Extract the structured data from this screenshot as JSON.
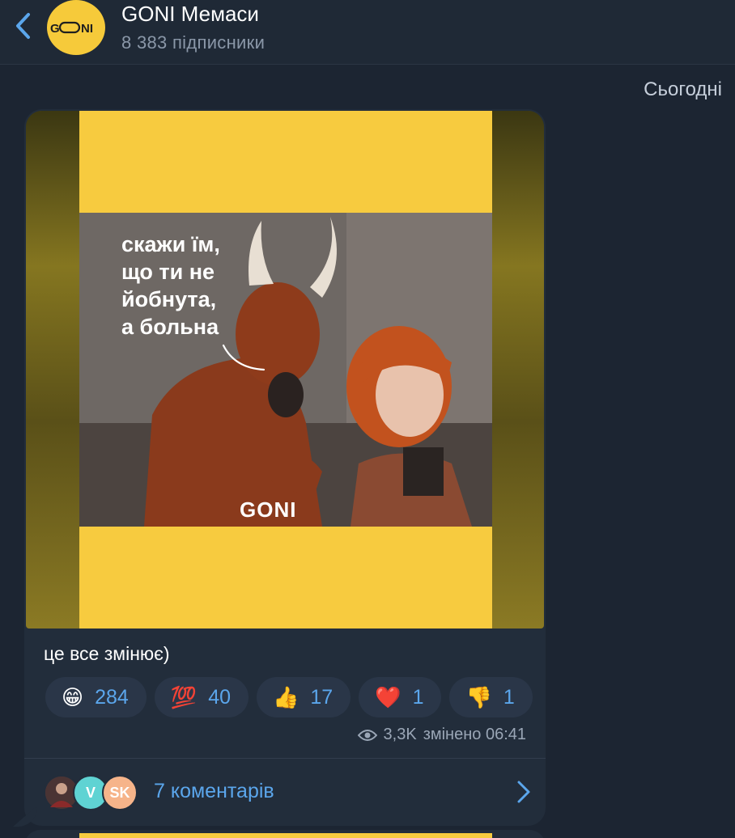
{
  "header": {
    "title": "GONI Мемаси",
    "subtitle": "8 383 підписники",
    "avatar_text": "GONI"
  },
  "date_chip": "Сьогодні",
  "message": {
    "meme_text": "скажи їм,\nщо ти не\nйобнута,\nа больна",
    "watermark": "GONI",
    "caption": "це все змінює)",
    "reactions": [
      {
        "emoji": "😁",
        "icon": "grinning-face-icon",
        "count": "284"
      },
      {
        "emoji": "💯",
        "icon": "hundred-points-icon",
        "count": "40"
      },
      {
        "emoji": "👍",
        "icon": "thumbs-up-icon",
        "count": "17"
      },
      {
        "emoji": "❤️",
        "icon": "red-heart-icon",
        "count": "1"
      },
      {
        "emoji": "👎",
        "icon": "thumbs-down-icon",
        "count": "1"
      }
    ],
    "views": "3,3K",
    "edited_time": "змінено 06:41"
  },
  "comments": {
    "label": "7 коментарів",
    "avatars": [
      {
        "letter": "",
        "color": "#5a3a3a"
      },
      {
        "letter": "V",
        "color": "#5fd3d3"
      },
      {
        "letter": "SK",
        "color": "#f6b48a"
      }
    ]
  },
  "colors": {
    "background": "#1c2532",
    "bubble": "#222d3b",
    "accent": "#5ba6ec",
    "brand_yellow": "#f7cb3f"
  }
}
